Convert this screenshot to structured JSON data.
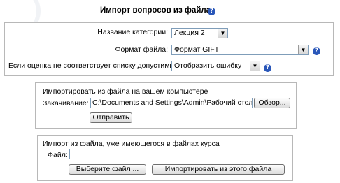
{
  "page": {
    "title": "Импорт вопросов из файла",
    "help_symbol": "?"
  },
  "settings": {
    "category_label": "Название категории:",
    "category_value": "Лекция 2",
    "format_label": "Формат файла:",
    "format_value": "Формат GIFT",
    "grade_label": "Если оценка не соответствует списку допустимых",
    "grade_value": "Отобразить ошибку"
  },
  "upload": {
    "legend": "Импортировать из файла на вашем компьютере",
    "file_label": "Закачивание:",
    "file_value": "C:\\Documents and Settings\\Admin\\Рабочий стол\\Questi",
    "browse_label": "Обзор...",
    "submit_label": "Отправить"
  },
  "course_file": {
    "legend": "Импорт из файла, уже имеющегося в файлах курса",
    "file_label": "Файл:",
    "file_value": "",
    "choose_label": "Выберите файл ...",
    "import_label": "Импортировать из этого файла"
  },
  "colors": {
    "help_icon": "#2a57b9",
    "frame_border": "#b8b8b8",
    "input_border": "#7f9db9"
  }
}
